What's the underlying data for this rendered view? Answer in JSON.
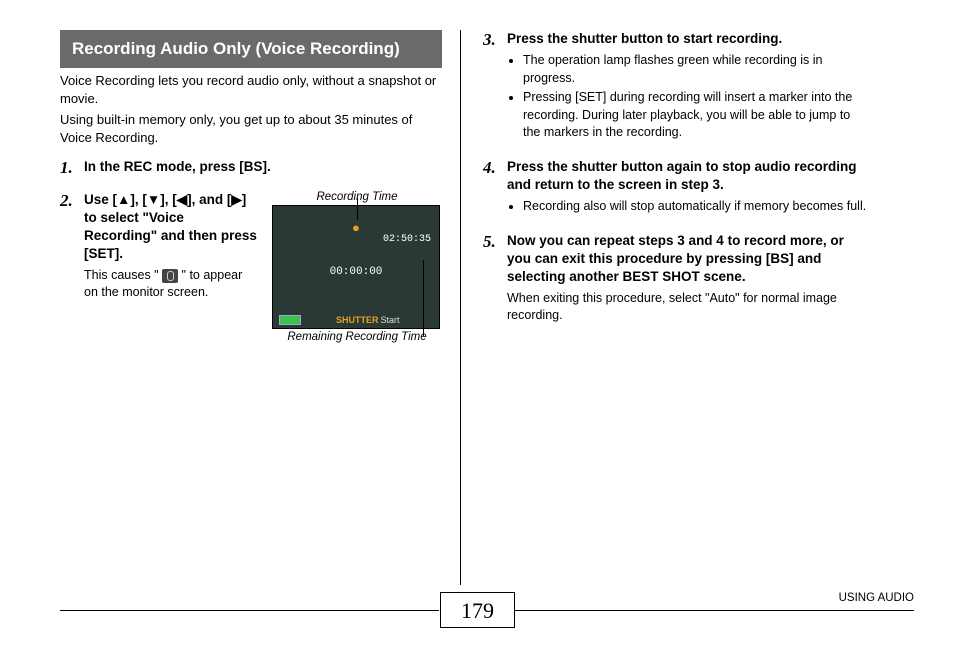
{
  "heading": "Recording Audio Only (Voice Recording)",
  "intro1": "Voice Recording lets you record audio only, without a snapshot or movie.",
  "intro2": "Using built-in memory only, you get up to about 35 minutes of Voice Recording.",
  "steps": {
    "s1": {
      "num": "1.",
      "title": "In the REC mode, press [BS]."
    },
    "s2": {
      "num": "2.",
      "title_pre": "Use [",
      "title_mid1": "], [",
      "title_mid2": "], [",
      "title_mid3": "], and [",
      "title_post": "] to select \"Voice Recording\" and then press [SET].",
      "desc_pre": "This causes \" ",
      "desc_post": " \" to appear on the monitor screen."
    },
    "s3": {
      "num": "3.",
      "title": "Press the shutter button to start recording.",
      "b1": "The operation lamp flashes green while recording is in progress.",
      "b2": "Pressing [SET] during recording will insert a marker into the recording. During later playback, you will be able to jump to the markers in the recording."
    },
    "s4": {
      "num": "4.",
      "title": "Press the shutter button again to stop audio recording and return to the screen in step 3.",
      "b1": "Recording also will stop automatically if memory becomes full."
    },
    "s5": {
      "num": "5.",
      "title": "Now you can repeat steps 3 and 4 to record more, or you can exit this procedure by pressing [BS] and selecting another BEST SHOT scene.",
      "desc": "When exiting this procedure, select \"Auto\" for normal image recording."
    }
  },
  "figure": {
    "top_label": "Recording Time",
    "bottom_label": "Remaining Recording Time",
    "rec_time": "02:50:35",
    "elapsed": "00:00:00",
    "shutter": "SHUTTER",
    "start": "Start"
  },
  "arrows": {
    "up": "▲",
    "down": "▼",
    "left": "◀",
    "right": "▶"
  },
  "footer": {
    "page": "179",
    "section": "USING AUDIO"
  }
}
